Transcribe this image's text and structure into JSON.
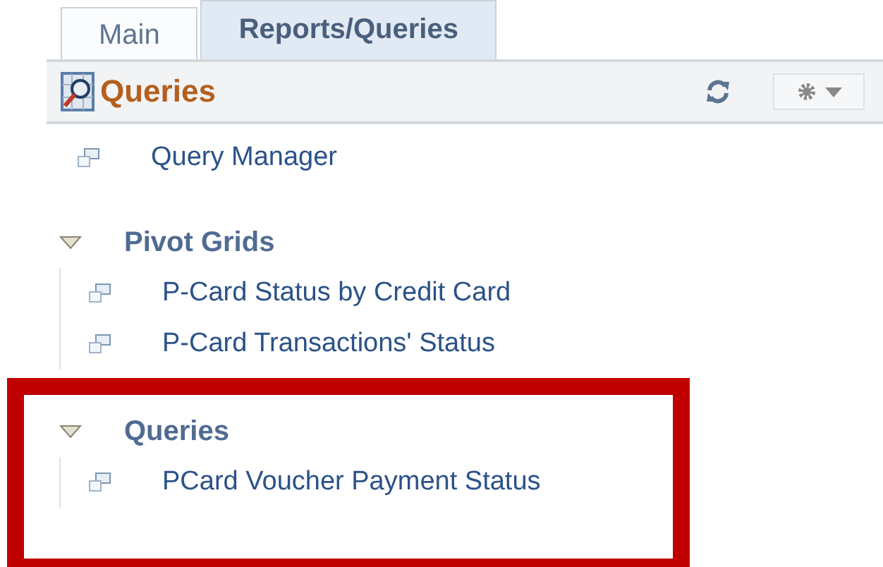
{
  "tabs": [
    {
      "label": "Main",
      "selected": false
    },
    {
      "label": "Reports/Queries",
      "selected": true
    }
  ],
  "pagelet": {
    "title": "Queries"
  },
  "links": [
    {
      "label": "Query Manager"
    }
  ],
  "groups": [
    {
      "label": "Pivot Grids",
      "expanded": true,
      "highlighted": false,
      "items": [
        {
          "label": "P-Card Status by Credit Card"
        },
        {
          "label": "P-Card Transactions' Status"
        }
      ]
    },
    {
      "label": "Queries",
      "expanded": true,
      "highlighted": true,
      "items": [
        {
          "label": "PCard Voucher Payment Status"
        }
      ]
    }
  ]
}
